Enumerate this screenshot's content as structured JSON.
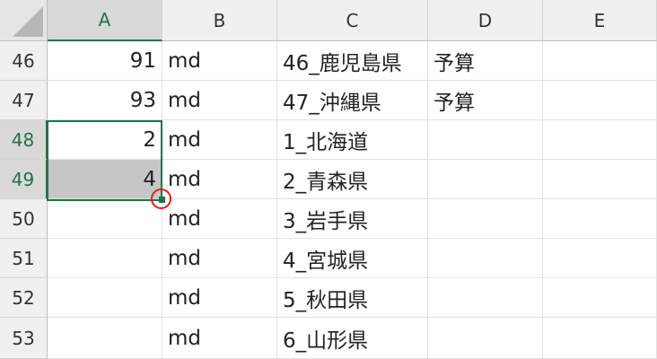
{
  "columns": [
    "A",
    "B",
    "C",
    "D",
    "E"
  ],
  "rows": [
    {
      "num": "46",
      "A": "91",
      "B": "md",
      "C": "46_鹿児島県",
      "D": "予算",
      "E": ""
    },
    {
      "num": "47",
      "A": "93",
      "B": "md",
      "C": "47_沖縄県",
      "D": "予算",
      "E": ""
    },
    {
      "num": "48",
      "A": "2",
      "B": "md",
      "C": "1_北海道",
      "D": "",
      "E": ""
    },
    {
      "num": "49",
      "A": "4",
      "B": "md",
      "C": "2_青森県",
      "D": "",
      "E": ""
    },
    {
      "num": "50",
      "A": "",
      "B": "md",
      "C": "3_岩手県",
      "D": "",
      "E": ""
    },
    {
      "num": "51",
      "A": "",
      "B": "md",
      "C": "4_宮城県",
      "D": "",
      "E": ""
    },
    {
      "num": "52",
      "A": "",
      "B": "md",
      "C": "5_秋田県",
      "D": "",
      "E": ""
    },
    {
      "num": "53",
      "A": "",
      "B": "md",
      "C": "6_山形県",
      "D": "",
      "E": ""
    }
  ],
  "selection": {
    "column": "A",
    "rows": [
      "48",
      "49"
    ],
    "active_cell": "A48"
  },
  "colors": {
    "accent": "#217346",
    "selection_fill": "#c6c6c6",
    "highlight_ring": "#e02020"
  }
}
